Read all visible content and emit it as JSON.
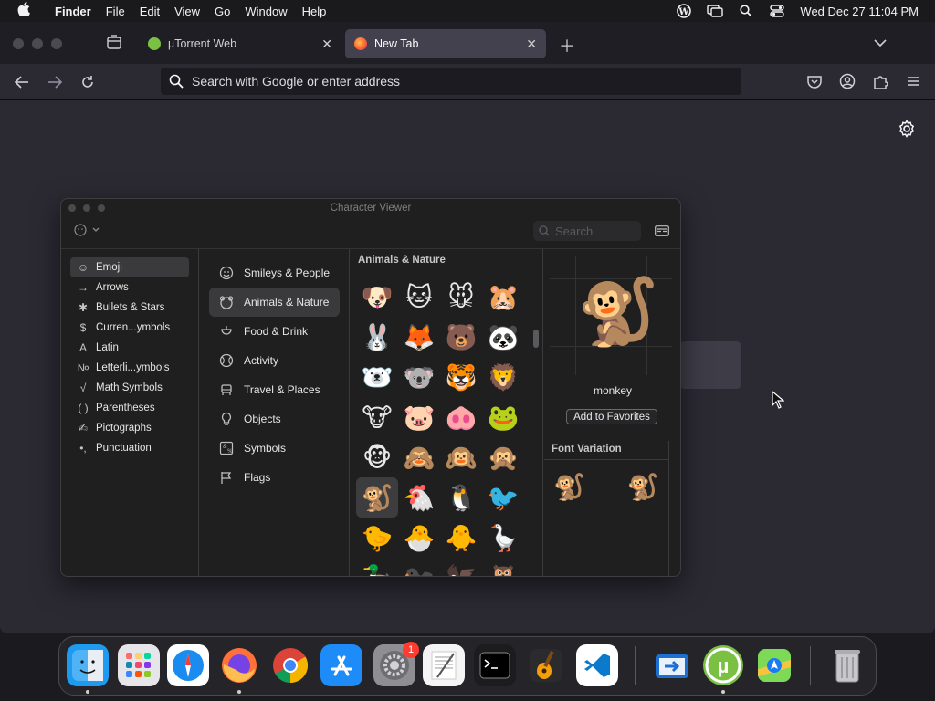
{
  "menubar": {
    "app_name": "Finder",
    "menus": [
      "File",
      "Edit",
      "View",
      "Go",
      "Window",
      "Help"
    ],
    "clock": "Wed Dec 27  11:04 PM"
  },
  "browser": {
    "tabs": [
      {
        "title": "µTorrent Web",
        "active": false
      },
      {
        "title": "New Tab",
        "active": true
      }
    ],
    "url_placeholder": "Search with Google or enter address"
  },
  "character_viewer": {
    "title": "Character Viewer",
    "search_placeholder": "Search",
    "categories": [
      {
        "label": "Emoji",
        "glyph": "☺",
        "selected": true
      },
      {
        "label": "Arrows",
        "glyph": "→",
        "selected": false
      },
      {
        "label": "Bullets & Stars",
        "glyph": "✱",
        "selected": false
      },
      {
        "label": "Curren...ymbols",
        "glyph": "$",
        "selected": false
      },
      {
        "label": "Latin",
        "glyph": "A",
        "selected": false
      },
      {
        "label": "Letterli...ymbols",
        "glyph": "№",
        "selected": false
      },
      {
        "label": "Math Symbols",
        "glyph": "√",
        "selected": false
      },
      {
        "label": "Parentheses",
        "glyph": "( )",
        "selected": false
      },
      {
        "label": "Pictographs",
        "glyph": "✍",
        "selected": false
      },
      {
        "label": "Punctuation",
        "glyph": "•,",
        "selected": false
      }
    ],
    "subcategories": [
      {
        "label": "Smileys & People",
        "icon": "smiley-icon",
        "selected": false
      },
      {
        "label": "Animals & Nature",
        "icon": "animal-icon",
        "selected": true
      },
      {
        "label": "Food & Drink",
        "icon": "food-icon",
        "selected": false
      },
      {
        "label": "Activity",
        "icon": "ball-icon",
        "selected": false
      },
      {
        "label": "Travel & Places",
        "icon": "car-icon",
        "selected": false
      },
      {
        "label": "Objects",
        "icon": "bulb-icon",
        "selected": false
      },
      {
        "label": "Symbols",
        "icon": "symbols-icon",
        "selected": false
      },
      {
        "label": "Flags",
        "icon": "flag-icon",
        "selected": false
      }
    ],
    "section_heading": "Animals & Nature",
    "emojis": [
      "🐶",
      "🐱",
      "🐭",
      "🐹",
      "🐰",
      "🦊",
      "🐻",
      "🐼",
      "🐻‍❄️",
      "🐨",
      "🐯",
      "🦁",
      "🐮",
      "🐷",
      "🐽",
      "🐸",
      "🐵",
      "🙈",
      "🙉",
      "🙊",
      "🐒",
      "🐔",
      "🐧",
      "🐦",
      "🐤",
      "🐣",
      "🐥",
      "🪿",
      "🦆",
      "🐦‍⬛",
      "🦅",
      "🦉"
    ],
    "selected_emoji_index": 20,
    "selected_char": "🐒",
    "selected_name": "monkey",
    "add_favorites_label": "Add to Favorites",
    "font_variation_heading": "Font Variation",
    "font_variations": [
      "🐒",
      "🐒"
    ]
  },
  "dock": {
    "apps": [
      {
        "name": "Finder",
        "icon": "finder-icon",
        "running": true
      },
      {
        "name": "Launchpad",
        "icon": "launchpad-icon",
        "running": false
      },
      {
        "name": "Safari",
        "icon": "safari-icon",
        "running": false
      },
      {
        "name": "Firefox",
        "icon": "firefox-icon",
        "running": true
      },
      {
        "name": "Chrome",
        "icon": "chrome-icon",
        "running": false
      },
      {
        "name": "App Store",
        "icon": "appstore-icon",
        "running": false
      },
      {
        "name": "System Settings",
        "icon": "settings-icon",
        "running": false,
        "badge": "1"
      },
      {
        "name": "TextEdit",
        "icon": "textedit-icon",
        "running": false
      },
      {
        "name": "Terminal",
        "icon": "terminal-icon",
        "running": false
      },
      {
        "name": "GarageBand",
        "icon": "garageband-icon",
        "running": false
      },
      {
        "name": "VS Code",
        "icon": "vscode-icon",
        "running": false
      },
      {
        "name": "Migration Assistant",
        "icon": "migration-icon",
        "running": false
      },
      {
        "name": "µTorrent",
        "icon": "utorrent-icon",
        "running": true
      },
      {
        "name": "Maps",
        "icon": "maps-icon",
        "running": false
      },
      {
        "name": "Trash",
        "icon": "trash-icon",
        "running": false
      }
    ]
  }
}
